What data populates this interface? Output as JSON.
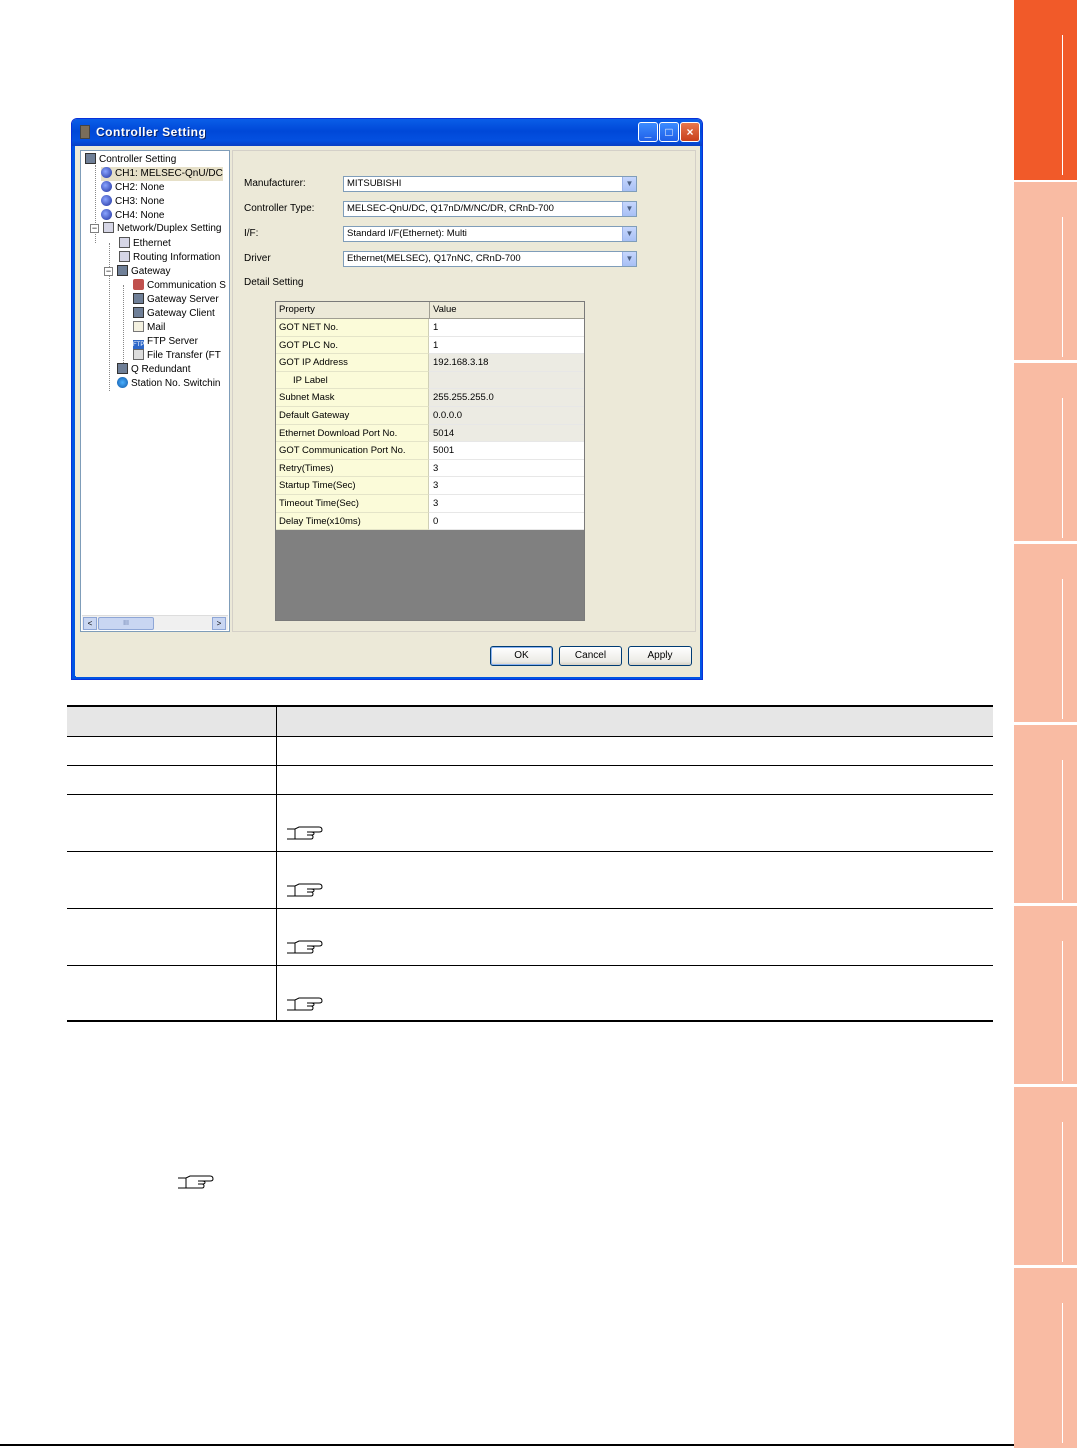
{
  "window": {
    "title": "Controller Setting",
    "controls": {
      "minimize": "_",
      "maximize": "□",
      "close": "×"
    }
  },
  "tree": {
    "items": [
      {
        "label": "Controller Setting",
        "icon": "controller-icon"
      },
      {
        "label": "CH1: MELSEC-QnU/DC",
        "icon": "ch1-icon",
        "selected": true
      },
      {
        "label": "CH2: None",
        "icon": "ch2-icon"
      },
      {
        "label": "CH3: None",
        "icon": "ch3-icon"
      },
      {
        "label": "CH4: None",
        "icon": "ch4-icon"
      },
      {
        "label": "Network/Duplex Setting",
        "icon": "network-icon"
      },
      {
        "label": "Ethernet",
        "icon": "ethernet-icon"
      },
      {
        "label": "Routing Information",
        "icon": "routing-icon"
      },
      {
        "label": "Gateway",
        "icon": "gateway-icon"
      },
      {
        "label": "Communication S",
        "icon": "communication-icon"
      },
      {
        "label": "Gateway Server",
        "icon": "gateway-server-icon"
      },
      {
        "label": "Gateway Client",
        "icon": "gateway-client-icon"
      },
      {
        "label": "Mail",
        "icon": "mail-icon"
      },
      {
        "label": "FTP Server",
        "icon": "ftp-server-icon"
      },
      {
        "label": "File Transfer (FT",
        "icon": "file-transfer-icon"
      },
      {
        "label": "Q Redundant",
        "icon": "q-redundant-icon"
      },
      {
        "label": "Station No. Switchin",
        "icon": "station-switch-icon"
      }
    ],
    "scroll": {
      "left": "<",
      "right": ">",
      "thumb": "III"
    }
  },
  "form": {
    "manufacturer_label": "Manufacturer:",
    "manufacturer_value": "MITSUBISHI",
    "controller_type_label": "Controller Type:",
    "controller_type_value": "MELSEC-QnU/DC, Q17nD/M/NC/DR, CRnD-700",
    "if_label": "I/F:",
    "if_value": "Standard I/F(Ethernet): Multi",
    "driver_label": "Driver",
    "driver_value": "Ethernet(MELSEC), Q17nNC, CRnD-700",
    "detail_label": "Detail Setting"
  },
  "grid": {
    "headers": {
      "property": "Property",
      "value": "Value"
    },
    "rows": [
      {
        "property": "GOT NET No.",
        "value": "1"
      },
      {
        "property": "GOT PLC No.",
        "value": "1"
      },
      {
        "property": "GOT IP Address",
        "value": "192.168.3.18"
      },
      {
        "property": "IP Label",
        "value": ""
      },
      {
        "property": "Subnet Mask",
        "value": "255.255.255.0"
      },
      {
        "property": "Default Gateway",
        "value": "0.0.0.0"
      },
      {
        "property": "Ethernet Download Port No.",
        "value": "5014"
      },
      {
        "property": "GOT Communication Port No.",
        "value": "5001"
      },
      {
        "property": "Retry(Times)",
        "value": "3"
      },
      {
        "property": "Startup Time(Sec)",
        "value": "3"
      },
      {
        "property": "Timeout Time(Sec)",
        "value": "3"
      },
      {
        "property": "Delay Time(x10ms)",
        "value": "0"
      }
    ]
  },
  "buttons": {
    "ok": "OK",
    "cancel": "Cancel",
    "apply": "Apply"
  },
  "colors": {
    "side_tab_active": "#f15a29",
    "side_tab_inactive": "#f9bba3",
    "titlebar": "#0054e3"
  }
}
